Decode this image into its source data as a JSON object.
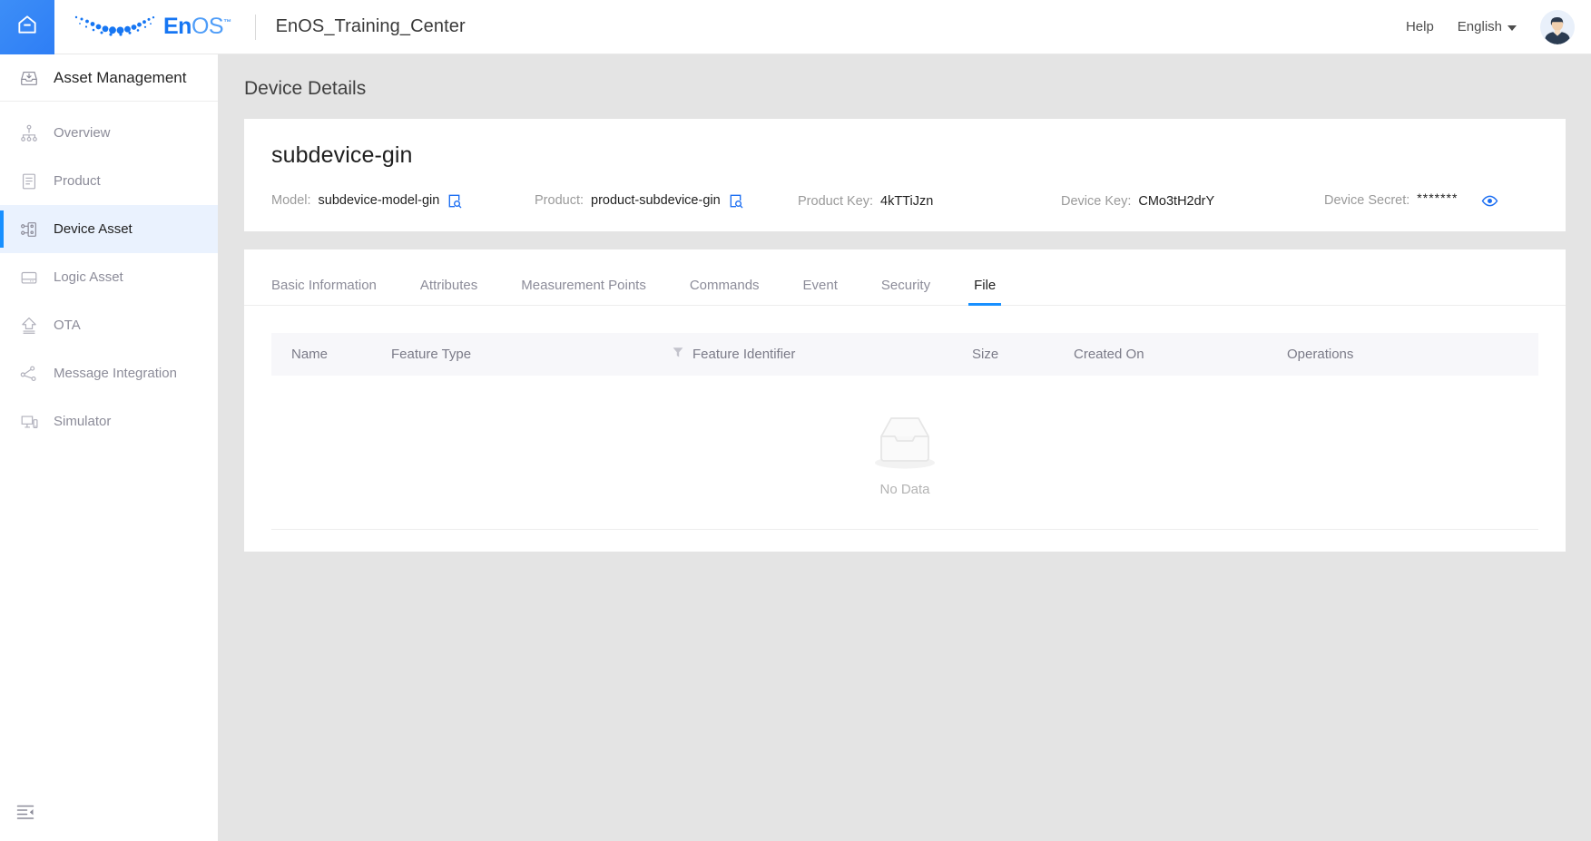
{
  "topbar": {
    "home_icon": "home-icon",
    "brand": {
      "en": "En",
      "os": "OS",
      "tm": "™"
    },
    "app_title": "EnOS_Training_Center",
    "help_label": "Help",
    "language_label": "English",
    "avatar_icon": "user-avatar"
  },
  "sidebar": {
    "header": {
      "label": "Asset Management",
      "icon": "inbox-download-icon"
    },
    "items": [
      {
        "label": "Overview",
        "icon": "sitemap-icon",
        "active": false
      },
      {
        "label": "Product",
        "icon": "document-icon",
        "active": false
      },
      {
        "label": "Device Asset",
        "icon": "device-node-icon",
        "active": true
      },
      {
        "label": "Logic Asset",
        "icon": "drive-icon",
        "active": false
      },
      {
        "label": "OTA",
        "icon": "upload-arrow-icon",
        "active": false
      },
      {
        "label": "Message Integration",
        "icon": "share-nodes-icon",
        "active": false
      },
      {
        "label": "Simulator",
        "icon": "monitor-device-icon",
        "active": false
      }
    ],
    "collapse_icon": "menu-fold-icon"
  },
  "page": {
    "title": "Device Details"
  },
  "device": {
    "name": "subdevice-gin",
    "fields": [
      {
        "key": "Model:",
        "value": "subdevice-model-gin",
        "action_icon": "file-search-icon"
      },
      {
        "key": "Product:",
        "value": "product-subdevice-gin",
        "action_icon": "file-search-icon"
      },
      {
        "key": "Product Key:",
        "value": "4kTTiJzn",
        "action_icon": null
      },
      {
        "key": "Device Key:",
        "value": "CMo3tH2drY",
        "action_icon": null
      },
      {
        "key": "Device Secret:",
        "value": "*******",
        "action_icon": "eye-icon"
      }
    ]
  },
  "tabs": [
    {
      "label": "Basic Information",
      "active": false
    },
    {
      "label": "Attributes",
      "active": false
    },
    {
      "label": "Measurement Points",
      "active": false
    },
    {
      "label": "Commands",
      "active": false
    },
    {
      "label": "Event",
      "active": false
    },
    {
      "label": "Security",
      "active": false
    },
    {
      "label": "File",
      "active": true
    }
  ],
  "table": {
    "columns": [
      {
        "label": "Name",
        "filter": false
      },
      {
        "label": "Feature Type",
        "filter": false
      },
      {
        "label": "Feature Identifier",
        "filter": true,
        "filter_icon": "filter-icon"
      },
      {
        "label": "Size",
        "filter": false
      },
      {
        "label": "Created On",
        "filter": false
      },
      {
        "label": "Operations",
        "filter": false
      }
    ],
    "rows": [],
    "empty_text": "No Data",
    "empty_icon": "empty-box-icon"
  },
  "colors": {
    "accent": "#1890ff",
    "home_blue": "#3081f5",
    "brand_blue": "#1676f3",
    "page_bg": "#e4e4e4",
    "active_nav_bg": "#eaf2fe",
    "table_header_bg": "#f7f7fa"
  }
}
